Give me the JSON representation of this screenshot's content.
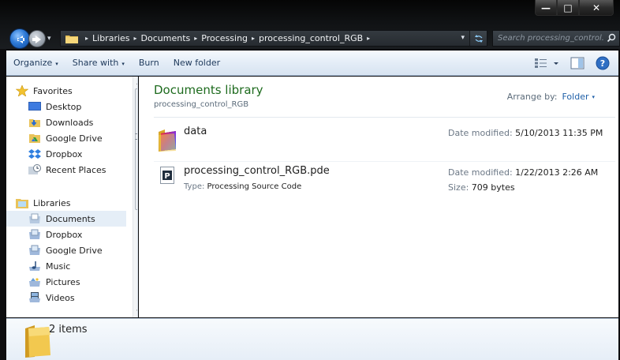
{
  "window": {
    "caption_minimize": "—",
    "caption_maximize": "□",
    "caption_close": "✕"
  },
  "address_bar": {
    "breadcrumbs": [
      "Libraries",
      "Documents",
      "Processing",
      "processing_control_RGB"
    ],
    "separator": "▸",
    "dropdown_glyph": "▾",
    "refresh_glyph": "⁺⁴"
  },
  "search": {
    "placeholder": "Search processing_control..."
  },
  "toolbar": {
    "organize_label": "Organize",
    "share_label": "Share with",
    "burn_label": "Burn",
    "new_folder_label": "New folder",
    "caret": "▾"
  },
  "navigation": {
    "favorites_header": "Favorites",
    "favorites": [
      {
        "label": "Desktop",
        "icon": "desktop-icon"
      },
      {
        "label": "Downloads",
        "icon": "downloads-icon"
      },
      {
        "label": "Google Drive",
        "icon": "google-drive-icon"
      },
      {
        "label": "Dropbox",
        "icon": "dropbox-icon"
      },
      {
        "label": "Recent Places",
        "icon": "recent-places-icon"
      }
    ],
    "libraries_header": "Libraries",
    "libraries": [
      {
        "label": "Documents",
        "icon": "documents-library-icon",
        "selected": true
      },
      {
        "label": "Dropbox",
        "icon": "dropbox-library-icon"
      },
      {
        "label": "Google Drive",
        "icon": "google-drive-library-icon"
      },
      {
        "label": "Music",
        "icon": "music-icon"
      },
      {
        "label": "Pictures",
        "icon": "pictures-icon"
      },
      {
        "label": "Videos",
        "icon": "videos-icon"
      }
    ]
  },
  "content": {
    "title": "Documents library",
    "subtitle": "processing_control_RGB",
    "arrange_label": "Arrange by:",
    "arrange_value": "Folder",
    "files": [
      {
        "name": "data",
        "kind": "folder",
        "date_label": "Date modified:",
        "date_value": "5/10/2013 11:35 PM"
      },
      {
        "name": "processing_control_RGB.pde",
        "kind": "processing-file",
        "type_label": "Type:",
        "type_value": "Processing Source Code",
        "date_label": "Date modified:",
        "date_value": "1/22/2013 2:26 AM",
        "size_label": "Size:",
        "size_value": "709 bytes"
      }
    ]
  },
  "details": {
    "item_count": "2 items"
  },
  "colors": {
    "library_title": "#1e6b1e",
    "toolbar_text": "#1e395b",
    "link_blue": "#1e5fa8",
    "selected_bg": "#e5eef7"
  }
}
